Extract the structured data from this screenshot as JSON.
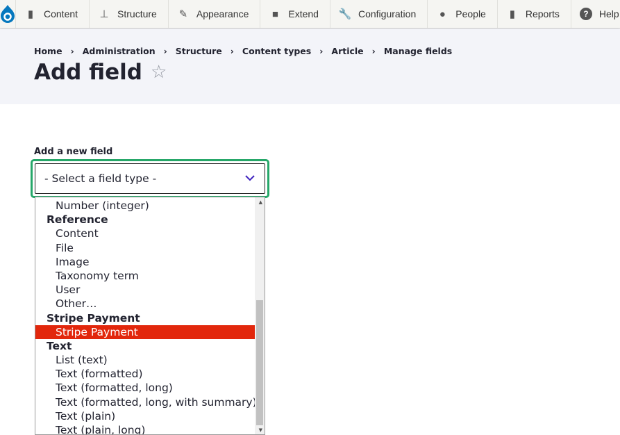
{
  "toolbar": {
    "items": [
      {
        "label": "Content",
        "icon": "file-icon"
      },
      {
        "label": "Structure",
        "icon": "sitemap-icon"
      },
      {
        "label": "Appearance",
        "icon": "brush-icon"
      },
      {
        "label": "Extend",
        "icon": "puzzle-icon"
      },
      {
        "label": "Configuration",
        "icon": "wrench-icon"
      },
      {
        "label": "People",
        "icon": "person-icon"
      },
      {
        "label": "Reports",
        "icon": "bar-chart-icon"
      },
      {
        "label": "Help",
        "icon": "help-icon"
      }
    ]
  },
  "breadcrumb": [
    "Home",
    "Administration",
    "Structure",
    "Content types",
    "Article",
    "Manage fields"
  ],
  "page": {
    "title": "Add field"
  },
  "form": {
    "label": "Add a new field",
    "select_value": "- Select a field type -"
  },
  "dropdown": {
    "items": [
      {
        "type": "option",
        "label": "Number (integer)"
      },
      {
        "type": "group",
        "label": "Reference"
      },
      {
        "type": "option",
        "label": "Content"
      },
      {
        "type": "option",
        "label": "File"
      },
      {
        "type": "option",
        "label": "Image"
      },
      {
        "type": "option",
        "label": "Taxonomy term"
      },
      {
        "type": "option",
        "label": "User"
      },
      {
        "type": "option",
        "label": "Other…"
      },
      {
        "type": "group",
        "label": "Stripe Payment"
      },
      {
        "type": "option",
        "label": "Stripe Payment",
        "selected": true
      },
      {
        "type": "group",
        "label": "Text"
      },
      {
        "type": "option",
        "label": "List (text)"
      },
      {
        "type": "option",
        "label": "Text (formatted)"
      },
      {
        "type": "option",
        "label": "Text (formatted, long)"
      },
      {
        "type": "option",
        "label": "Text (formatted, long, with summary)"
      },
      {
        "type": "option",
        "label": "Text (plain)"
      },
      {
        "type": "option",
        "label": "Text (plain, long)"
      }
    ]
  },
  "colors": {
    "accent": "#e2270c",
    "focus": "#26a769",
    "brand": "#0678be"
  }
}
